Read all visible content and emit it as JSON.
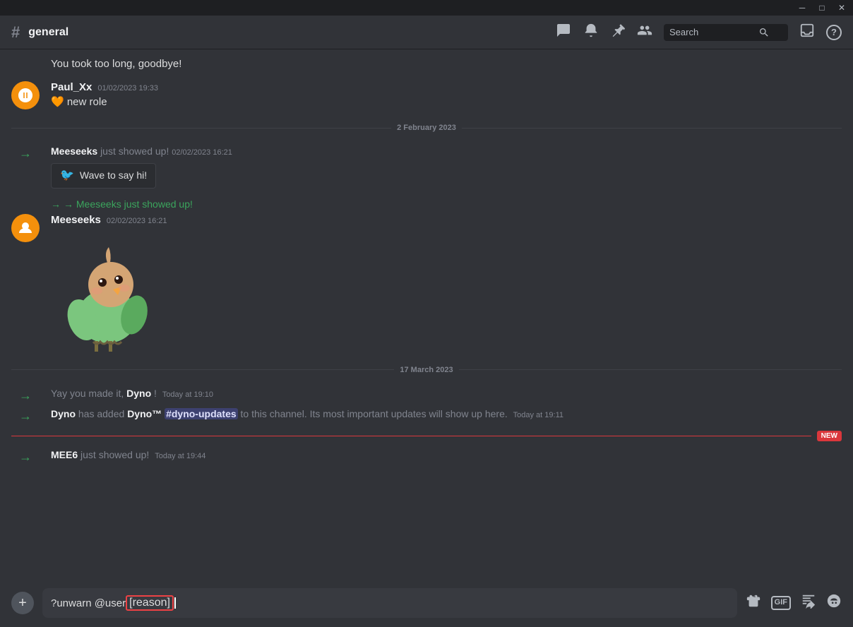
{
  "titleBar": {
    "minimizeLabel": "─",
    "maximizeLabel": "□",
    "closeLabel": "✕"
  },
  "header": {
    "hash": "#",
    "channelName": "general",
    "icons": {
      "threads": "⊞",
      "notifications": "🔔",
      "pinned": "📌",
      "members": "👤"
    },
    "search": {
      "placeholder": "Search",
      "value": ""
    },
    "inboxIcon": "⊡",
    "helpIcon": "?"
  },
  "messages": {
    "topTruncated": "You took too long, goodbye!",
    "dateDividers": {
      "feb": "2 February 2023",
      "mar": "17 March 2023"
    },
    "paulMsg": {
      "username": "Paul_Xx",
      "timestamp": "01/02/2023 19:33",
      "text": "🧡 new role"
    },
    "meeseeks1": {
      "username": "Meeseeks",
      "action": "just showed up!",
      "timestamp": "02/02/2023 16:21",
      "waveButton": "Wave to say hi!"
    },
    "meeseeks2": {
      "joinedLine": "→ Meeseeks just showed up!",
      "username": "Meeseeks",
      "timestamp": "02/02/2023 16:21"
    },
    "dynoWelcome": {
      "text": "Yay you made it, ",
      "boldName": "Dyno",
      "suffix": "!",
      "timestamp": "Today at 19:10"
    },
    "dynoAdded": {
      "username": "Dyno",
      "action1": " has added ",
      "boldBot": "Dyno™",
      "channel": "#dyno-updates",
      "action2": " to this channel. Its most important updates will show up here.",
      "timestamp": "Today at 19:11"
    },
    "mee6Joined": {
      "username": "MEE6",
      "action": " just showed up!",
      "timestamp": "Today at 19:44"
    }
  },
  "inputBox": {
    "prefix": "?unwarn @user ",
    "reasonText": "[reason]",
    "plusIcon": "+",
    "giftIcon": "🎁",
    "gifLabel": "GIF",
    "uploadIcon": "⬆",
    "emojiIcon": "🙂"
  },
  "newBadge": "NEW",
  "actionIcons": {
    "react": "😊",
    "reply": "↩",
    "more": "···",
    "appCommand": "⊕"
  }
}
